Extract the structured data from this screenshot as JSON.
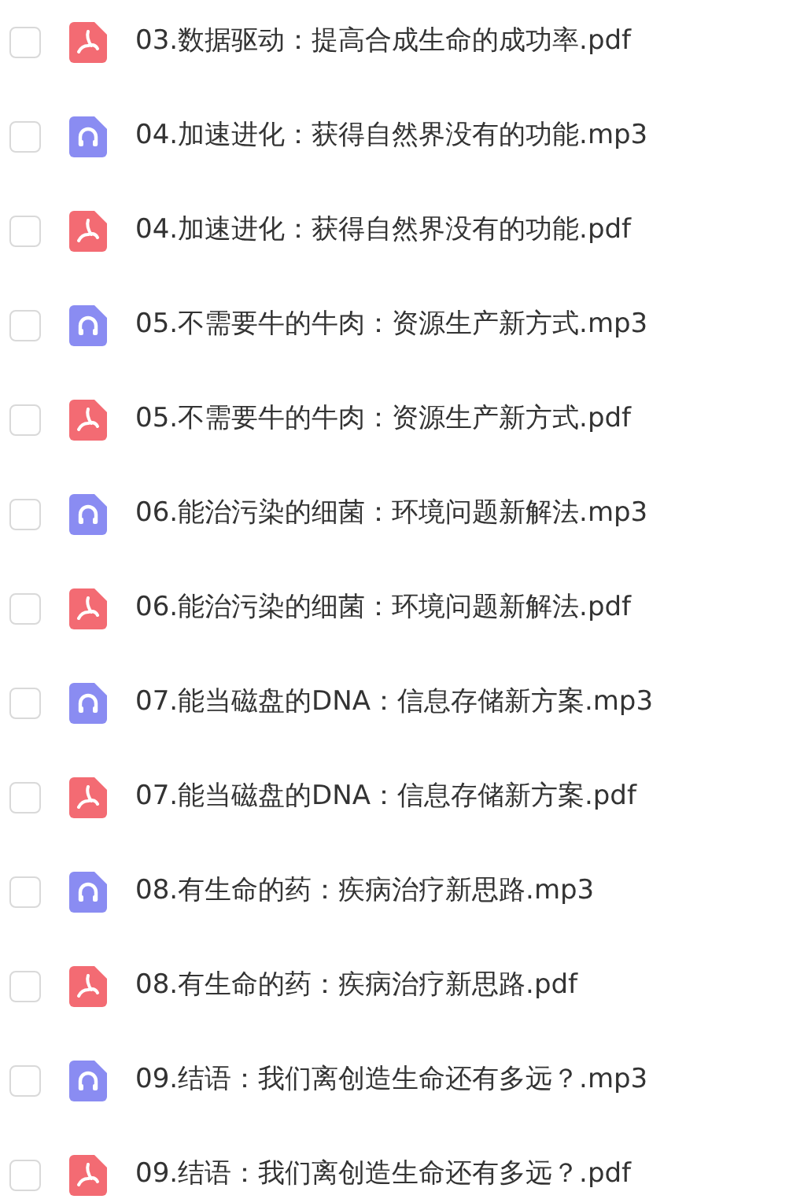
{
  "files": [
    {
      "name": "03.数据驱动：提高合成生命的成功率.pdf",
      "kind": "pdf",
      "checked": false
    },
    {
      "name": "04.加速进化：获得自然界没有的功能.mp3",
      "kind": "audio",
      "checked": false
    },
    {
      "name": "04.加速进化：获得自然界没有的功能.pdf",
      "kind": "pdf",
      "checked": false
    },
    {
      "name": "05.不需要牛的牛肉：资源生产新方式.mp3",
      "kind": "audio",
      "checked": false
    },
    {
      "name": "05.不需要牛的牛肉：资源生产新方式.pdf",
      "kind": "pdf",
      "checked": false
    },
    {
      "name": "06.能治污染的细菌：环境问题新解法.mp3",
      "kind": "audio",
      "checked": false
    },
    {
      "name": "06.能治污染的细菌：环境问题新解法.pdf",
      "kind": "pdf",
      "checked": false
    },
    {
      "name": "07.能当磁盘的DNA：信息存储新方案.mp3",
      "kind": "audio",
      "checked": false
    },
    {
      "name": "07.能当磁盘的DNA：信息存储新方案.pdf",
      "kind": "pdf",
      "checked": false
    },
    {
      "name": "08.有生命的药：疾病治疗新思路.mp3",
      "kind": "audio",
      "checked": false
    },
    {
      "name": "08.有生命的药：疾病治疗新思路.pdf",
      "kind": "pdf",
      "checked": false
    },
    {
      "name": "09.结语：我们离创造生命还有多远？.mp3",
      "kind": "audio",
      "checked": false
    },
    {
      "name": "09.结语：我们离创造生命还有多远？.pdf",
      "kind": "pdf",
      "checked": false
    }
  ]
}
